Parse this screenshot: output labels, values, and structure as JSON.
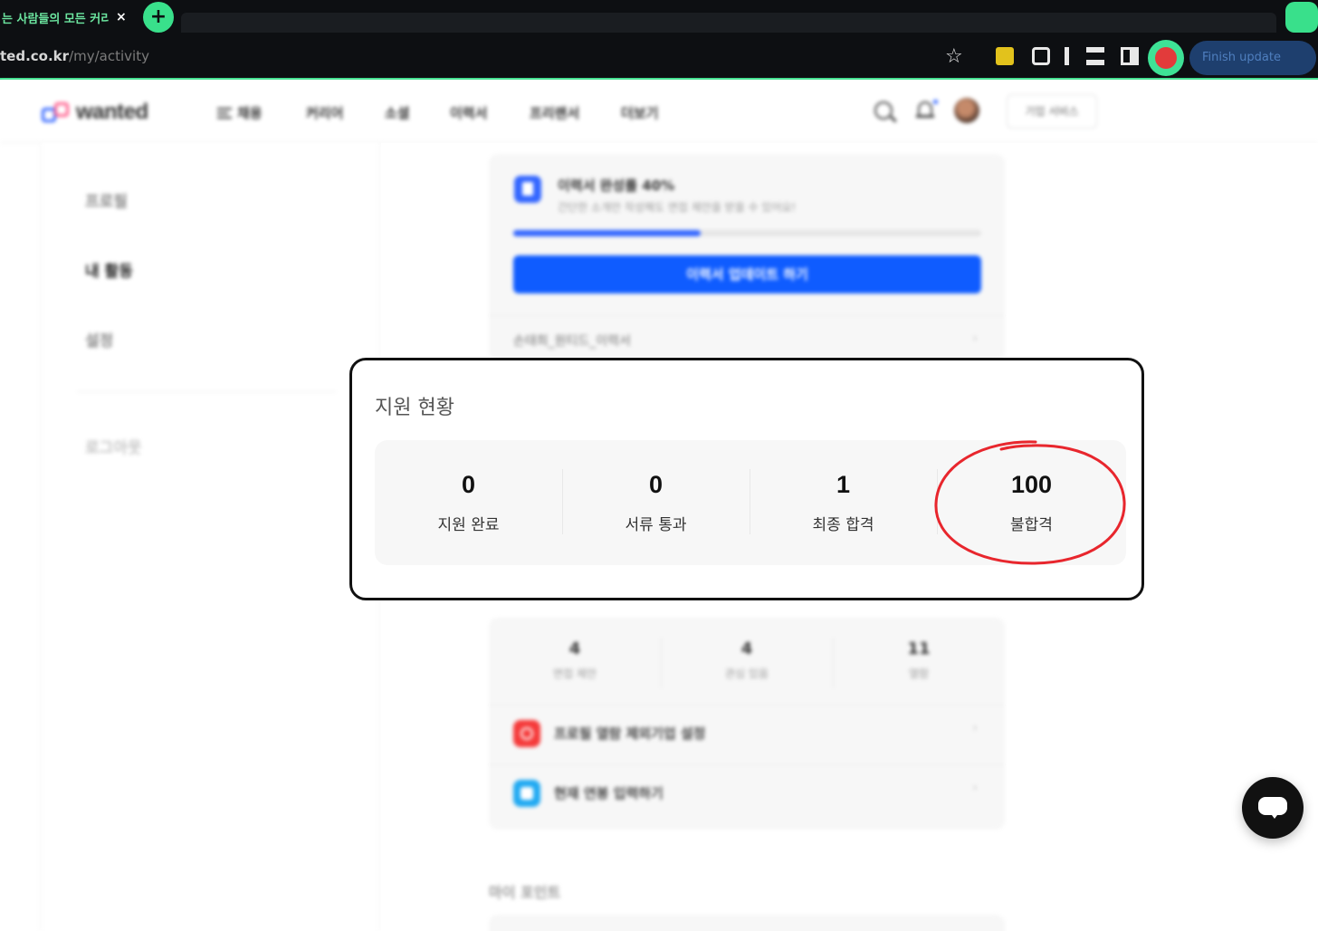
{
  "browser": {
    "tab_title": "는 사람들의 모든 커리",
    "tab_close": "×",
    "new_tab": "+",
    "url_domain": "ted.co.kr",
    "url_path": "/my/activity",
    "update_button": "Finish update"
  },
  "header": {
    "logo_text": "wanted",
    "nav": [
      "채용",
      "커리어",
      "소셜",
      "이력서",
      "프리랜서",
      "더보기"
    ],
    "business_button": "기업 서비스"
  },
  "sidebar": {
    "items": [
      "프로필",
      "내 활동",
      "설정"
    ],
    "active_index": 1,
    "logout": "로그아웃"
  },
  "resume": {
    "title": "이력서 완성률 40%",
    "subtitle": "간단한 소개만 작성해도 면접 제안을 받을 수 있어요!",
    "progress_percent": 40,
    "update_button": "이력서 업데이트 하기",
    "resume_name": "손태희_원티드_이력서",
    "chevron": "›"
  },
  "activity_stats": [
    {
      "value": "4",
      "label": "면접 제안"
    },
    {
      "value": "4",
      "label": "관심 있음"
    },
    {
      "value": "11",
      "label": "열람"
    }
  ],
  "activity_rows": [
    {
      "label": "프로필 열람 제외기업 설정",
      "icon": "block-icon",
      "color": "#f53b3b"
    },
    {
      "label": "현재 연봉 입력하기",
      "icon": "document-icon",
      "color": "#22aaf2"
    }
  ],
  "my_point_label": "마이 포인트",
  "application_status": {
    "title": "지원 현황",
    "items": [
      {
        "value": "0",
        "label": "지원 완료"
      },
      {
        "value": "0",
        "label": "서류 통과"
      },
      {
        "value": "1",
        "label": "최종 합격"
      },
      {
        "value": "100",
        "label": "불합격"
      }
    ],
    "highlighted_index": 3,
    "highlight_color": "#e8262d"
  },
  "colors": {
    "brand_blue": "#3366ff",
    "button_blue": "#0f5cff",
    "browser_accent": "#39e08b",
    "chrome_dark": "#0d0f12"
  }
}
